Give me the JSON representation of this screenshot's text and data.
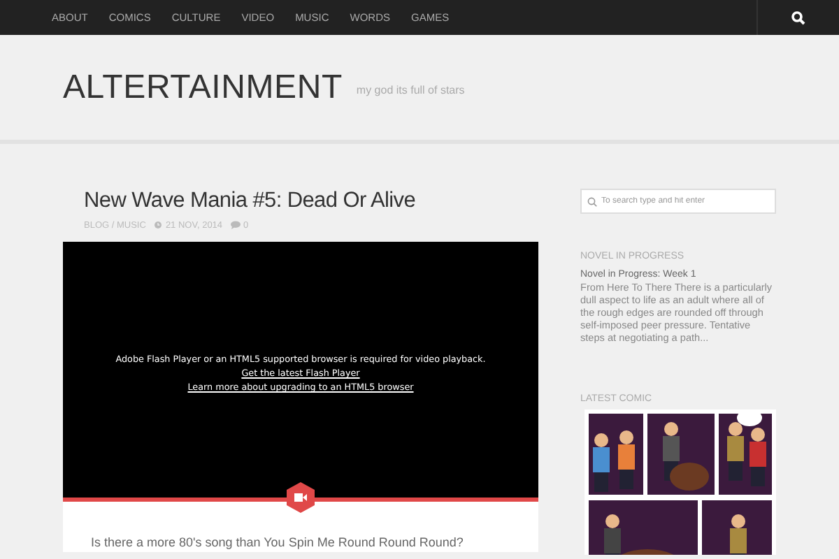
{
  "nav": {
    "items": [
      "ABOUT",
      "COMICS",
      "CULTURE",
      "VIDEO",
      "MUSIC",
      "WORDS",
      "GAMES"
    ]
  },
  "header": {
    "site_title": "ALTERTAINMENT",
    "tagline": "my god its full of stars"
  },
  "post": {
    "title": "New Wave Mania #5: Dead Or Alive",
    "categories": "BLOG / MUSIC",
    "date": "21 NOV, 2014",
    "comments": "0",
    "video": {
      "message": "Adobe Flash Player or an HTML5 supported browser is required for video playback.",
      "links": [
        "Get the latest Flash Player",
        "Learn more about upgrading to an HTML5 browser"
      ]
    },
    "excerpt": "Is there a more 80's song than You Spin Me Round Round Round?"
  },
  "sidebar": {
    "search": {
      "placeholder": "To search type and hit enter"
    },
    "widgets": [
      {
        "kind": "text",
        "heading": "NOVEL IN PROGRESS",
        "title": "Novel in Progress: Week 1",
        "body": "From Here To There There is a particularly dull aspect to life as an adult where all of the rough edges are rounded off through self-imposed peer pressure.  Tentative steps at negotiating a path..."
      },
      {
        "kind": "picture",
        "heading": "LATEST COMIC"
      }
    ]
  }
}
